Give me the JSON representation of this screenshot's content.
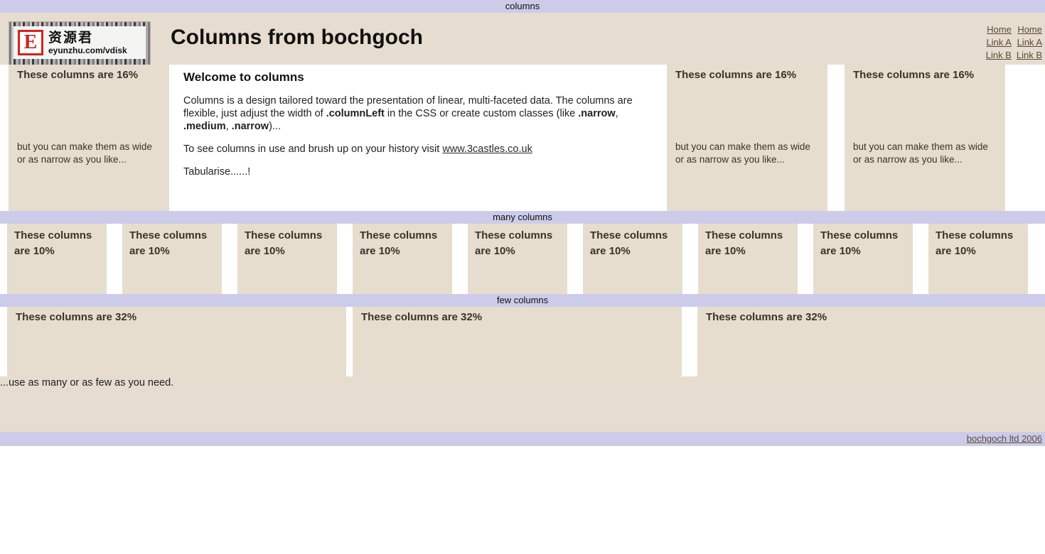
{
  "topbar": {
    "label": "columns"
  },
  "header": {
    "title": "Columns from bochgoch",
    "logo": {
      "mark": "E",
      "chinese": "资源君",
      "url": "eyunzhu.com/vdisk"
    },
    "nav_columns": [
      {
        "links": [
          "Home",
          "Link A",
          "Link B"
        ]
      },
      {
        "links": [
          "Home",
          "Link A",
          "Link B"
        ]
      }
    ]
  },
  "top_section": {
    "left_column": {
      "heading": "These columns are 16%",
      "body": "but you can make them as wide or as narrow as you like..."
    },
    "main_column": {
      "heading": "Welcome to columns",
      "para1_a": "Columns is a design tailored toward the presentation of linear, multi-faceted data. The columns are flexible, just adjust the width of ",
      "para1_code1": ".columnLeft",
      "para1_b": " in the CSS or create custom classes (like ",
      "para1_code2": ".narrow",
      "para1_c": ", ",
      "para1_code3": ".medium",
      "para1_d": ", ",
      "para1_code4": ".narrow",
      "para1_e": ")...",
      "para2_a": "To see columns in use and brush up on your history visit ",
      "para2_link": "www.3castles.co.uk",
      "para3": "Tabularise......!"
    },
    "right_columns": [
      {
        "heading": "These columns are 16%",
        "body": "but you can make them as wide or as narrow as you like..."
      },
      {
        "heading": "These columns are 16%",
        "body": "but you can make them as wide or as narrow as you like..."
      }
    ]
  },
  "many_section": {
    "bar_label": "many columns",
    "columns": [
      {
        "heading": "These columns are 10%"
      },
      {
        "heading": "These columns are 10%"
      },
      {
        "heading": "These columns are 10%"
      },
      {
        "heading": "These columns are 10%"
      },
      {
        "heading": "These columns are 10%"
      },
      {
        "heading": "These columns are 10%"
      },
      {
        "heading": "These columns are 10%"
      },
      {
        "heading": "These columns are 10%"
      },
      {
        "heading": "These columns are 10%"
      }
    ]
  },
  "few_section": {
    "bar_label": "few columns",
    "columns": [
      {
        "heading": "These columns are 32%"
      },
      {
        "heading": "These columns are 32%"
      },
      {
        "heading": "These columns are 32%"
      }
    ]
  },
  "tail_note": "...use as many or as few as you need.",
  "footer": {
    "copyright": "bochgoch ltd 2006"
  },
  "colors": {
    "bar": "#ccccea",
    "column_bg": "#e6ddcf",
    "header_bg": "#e6ddd0",
    "link": "#5a4a33",
    "logo_red": "#d0241f"
  }
}
